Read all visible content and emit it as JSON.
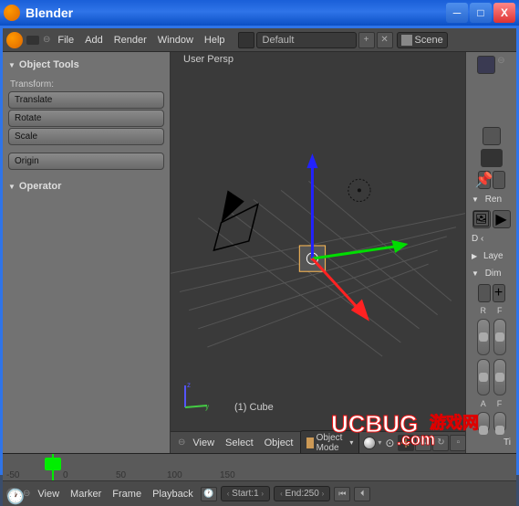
{
  "window": {
    "title": "Blender"
  },
  "menu": {
    "file": "File",
    "add": "Add",
    "render": "Render",
    "window": "Window",
    "help": "Help"
  },
  "topbar": {
    "layout": "Default",
    "scene": "Scene"
  },
  "tool_panel": {
    "header": "Object Tools",
    "transform_label": "Transform:",
    "translate": "Translate",
    "rotate": "Rotate",
    "scale": "Scale",
    "origin": "Origin",
    "operator_header": "Operator"
  },
  "viewport": {
    "persp": "User Persp",
    "object": "(1) Cube",
    "header": {
      "view": "View",
      "select": "Select",
      "object": "Object",
      "mode": "Object Mode"
    }
  },
  "properties": {
    "render": "Ren",
    "dim": "D",
    "layers": "Laye",
    "dimensions": "Dim",
    "r": "R",
    "f": "F",
    "a": "A",
    "ff": "F",
    "ti": "Ti"
  },
  "timeline": {
    "ticks": [
      "-50",
      "0",
      "50",
      "100",
      "150"
    ],
    "menu": {
      "view": "View",
      "marker": "Marker",
      "frame": "Frame",
      "playback": "Playback"
    },
    "start_label": "Start:",
    "start": "1",
    "end_label": "End:",
    "end": "250"
  },
  "watermark": {
    "brand": "UCBUG",
    "suffix1": "游戏网",
    "domain": ".com"
  }
}
